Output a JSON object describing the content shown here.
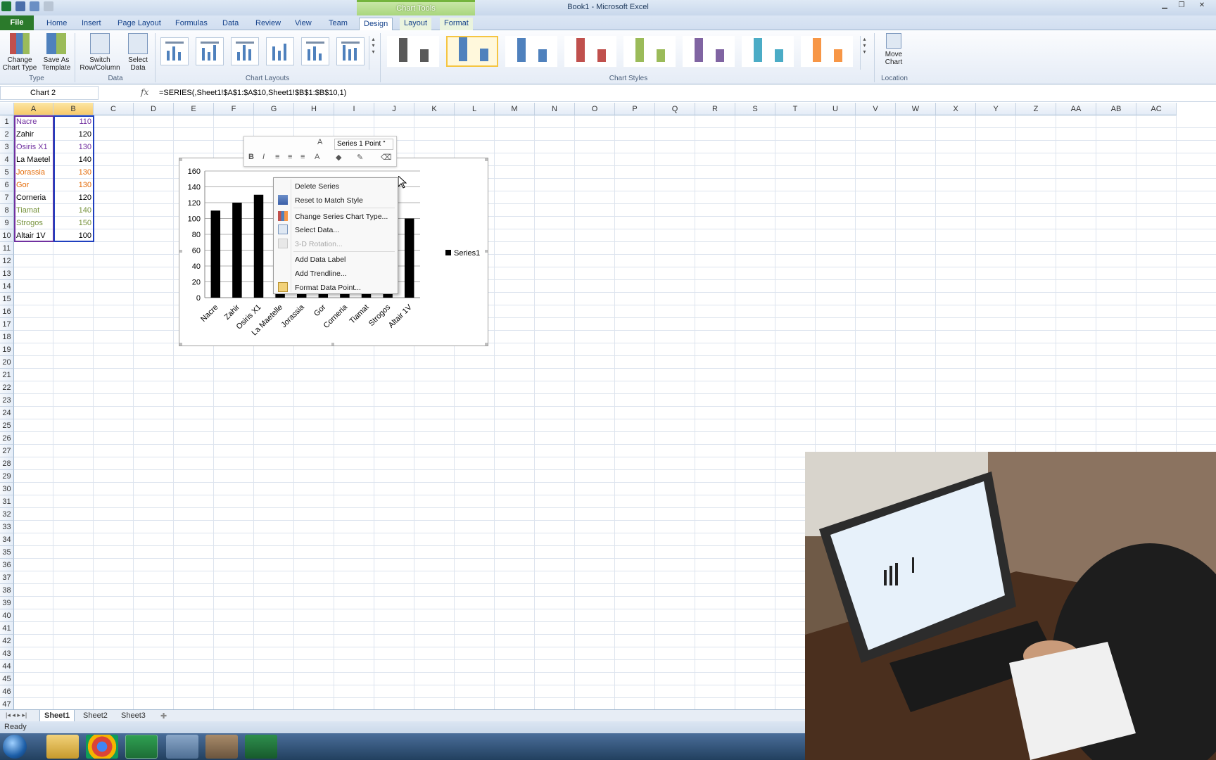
{
  "window": {
    "title": "Book1 - Microsoft Excel",
    "context_tab": "Chart Tools"
  },
  "tabs": [
    "File",
    "Home",
    "Insert",
    "Page Layout",
    "Formulas",
    "Data",
    "Review",
    "View",
    "Team",
    "Design",
    "Layout",
    "Format"
  ],
  "ribbon": {
    "change_chart_type": "Change Chart Type",
    "save_as_template": "Save As Template",
    "switch_row_column": "Switch Row/Column",
    "select_data": "Select Data",
    "move_chart": "Move Chart",
    "groups": {
      "type": "Type",
      "data": "Data",
      "chart_layouts": "Chart Layouts",
      "chart_styles": "Chart Styles",
      "location": "Location"
    },
    "style_colors": [
      "#595959",
      "#4f81bd",
      "#4f81bd",
      "#c0504d",
      "#9bbb59",
      "#8064a2",
      "#4bacc6",
      "#f79646"
    ]
  },
  "formula_bar": {
    "name_box": "Chart 2",
    "fx": "fx",
    "formula": "=SERIES(,Sheet1!$A$1:$A$10,Sheet1!$B$1:$B$10,1)"
  },
  "columns": [
    "A",
    "B",
    "C",
    "D",
    "E",
    "F",
    "G",
    "H",
    "I",
    "J",
    "K",
    "L",
    "M",
    "N",
    "O",
    "P",
    "Q",
    "R",
    "S",
    "T",
    "U",
    "V",
    "W",
    "X",
    "Y",
    "Z",
    "AA",
    "AB",
    "AC"
  ],
  "rows": [
    "1",
    "2",
    "3",
    "4",
    "5",
    "6",
    "7",
    "8",
    "9",
    "10",
    "11",
    "12",
    "13",
    "14",
    "15",
    "16",
    "17",
    "18",
    "19",
    "20",
    "21",
    "22",
    "23",
    "24",
    "25",
    "26",
    "27",
    "28",
    "29",
    "30",
    "31",
    "32",
    "33",
    "34",
    "35",
    "36",
    "37",
    "38",
    "39",
    "40",
    "41",
    "42",
    "43",
    "44",
    "45",
    "46",
    "47"
  ],
  "cells": [
    {
      "name": "Nacre",
      "value": "110",
      "color": "#7030a0"
    },
    {
      "name": "Zahir",
      "value": "120",
      "color": "#000000"
    },
    {
      "name": "Osiris X1",
      "value": "130",
      "color": "#7030a0"
    },
    {
      "name": "La Maetel",
      "value": "140",
      "color": "#000000"
    },
    {
      "name": "Jorassia",
      "value": "130",
      "color": "#e46c0a"
    },
    {
      "name": "Gor",
      "value": "130",
      "color": "#e46c0a"
    },
    {
      "name": "Corneria",
      "value": "120",
      "color": "#000000"
    },
    {
      "name": "Tiamat",
      "value": "140",
      "color": "#76923c"
    },
    {
      "name": "Strogos",
      "value": "150",
      "color": "#76923c"
    },
    {
      "name": "Altair 1V",
      "value": "100",
      "color": "#000000"
    }
  ],
  "chart_data": {
    "type": "bar",
    "categories": [
      "Nacre",
      "Zahir",
      "Osiris X1",
      "La Maetelle",
      "Jorassia",
      "Gor",
      "Corneria",
      "Tiamat",
      "Strogos",
      "Altair 1V"
    ],
    "series": [
      {
        "name": "Series1",
        "values": [
          110,
          120,
          130,
          140,
          130,
          130,
          120,
          140,
          150,
          100
        ]
      }
    ],
    "ylim": [
      0,
      160
    ],
    "yticks": [
      "0",
      "20",
      "40",
      "60",
      "80",
      "100",
      "120",
      "140",
      "160"
    ],
    "legend": "right",
    "grid": true,
    "bar_color": "#000000"
  },
  "mini_toolbar": {
    "series_selector": "Series 1 Point \""
  },
  "context_menu": [
    {
      "label": "Delete Series",
      "disabled": false
    },
    {
      "label": "Reset to Match Style",
      "disabled": false
    },
    {
      "label": "Change Series Chart Type...",
      "disabled": false
    },
    {
      "label": "Select Data...",
      "disabled": false
    },
    {
      "label": "3-D Rotation...",
      "disabled": true
    },
    {
      "label": "Add Data Label",
      "disabled": false
    },
    {
      "label": "Add Trendline...",
      "disabled": false
    },
    {
      "label": "Format Data Point...",
      "disabled": false
    }
  ],
  "sheets": [
    "Sheet1",
    "Sheet2",
    "Sheet3"
  ],
  "status": "Ready"
}
